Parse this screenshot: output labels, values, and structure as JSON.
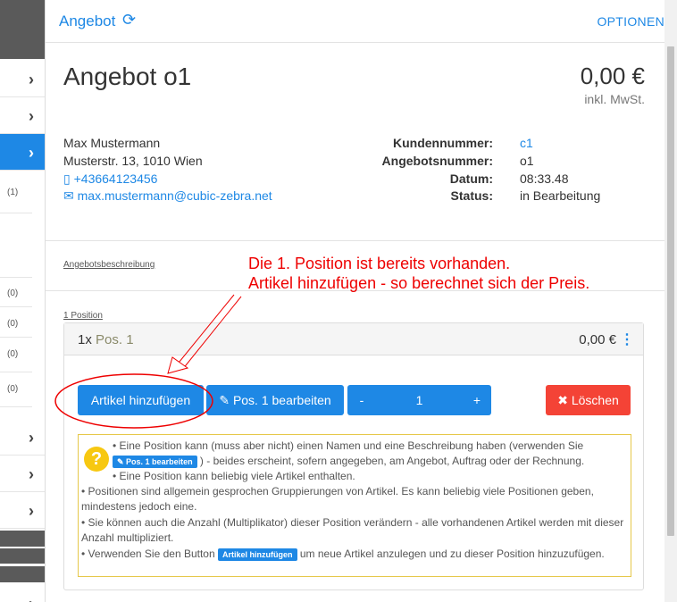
{
  "header": {
    "title": "Angebot",
    "options_label": "OPTIONEN"
  },
  "sidebar": {
    "counts": [
      "(1)",
      "(0)",
      "(0)",
      "(0)",
      "(0)"
    ]
  },
  "offer": {
    "title": "Angebot o1",
    "price": "0,00 €",
    "price_note": "inkl. MwSt."
  },
  "customer": {
    "name": "Max Mustermann",
    "address": "Musterstr. 13, 1010 Wien",
    "phone": "+43664123456",
    "email": "max.mustermann@cubic-zebra.net"
  },
  "meta": {
    "labels": [
      "Kundennummer:",
      "Angebotsnummer:",
      "Datum:",
      "Status:"
    ],
    "values": [
      "c1",
      "o1",
      "08:33.48",
      "in Bearbeitung"
    ]
  },
  "description_link": "Angebotsbeschreibung",
  "annotation": {
    "line1": "Die 1. Position ist bereits vorhanden.",
    "line2": "Artikel hinzufügen - so berechnet sich der Preis."
  },
  "positions": {
    "count_link": "1 Position",
    "qty": "1x",
    "name": "Pos. 1",
    "amount": "0,00 €"
  },
  "actions": {
    "add_article": "Artikel hinzufügen",
    "edit_position": "Pos. 1 bearbeiten",
    "minus": "-",
    "quantity": "1",
    "plus": "+",
    "delete": "Löschen"
  },
  "info": {
    "b1_pre": "Eine Position kann (muss aber nicht) einen Namen und eine Beschreibung haben (verwenden Sie",
    "b1_btn": "Pos. 1 bearbeiten",
    "b1_post": ") - beides erscheint, sofern angegeben, am Angebot, Auftrag oder der Rechnung.",
    "b2": "Eine Position kann beliebig viele Artikel enthalten.",
    "b3": "Positionen sind allgemein gesprochen Gruppierungen von Artikel. Es kann beliebig viele Positionen geben, mindestens jedoch eine.",
    "b4": "Sie können auch die Anzahl (Multiplikator) dieser Position verändern - alle vorhandenen Artikel werden mit dieser Anzahl multipliziert.",
    "b5_pre": "Verwenden Sie den Button",
    "b5_btn": "Artikel hinzufügen",
    "b5_post": "um neue Artikel anzulegen und zu dieser Position hinzuzufügen."
  },
  "colors": {
    "primary": "#1e88e5",
    "danger": "#f44336",
    "annotation": "#e00000",
    "info_border": "#e6c84a"
  }
}
